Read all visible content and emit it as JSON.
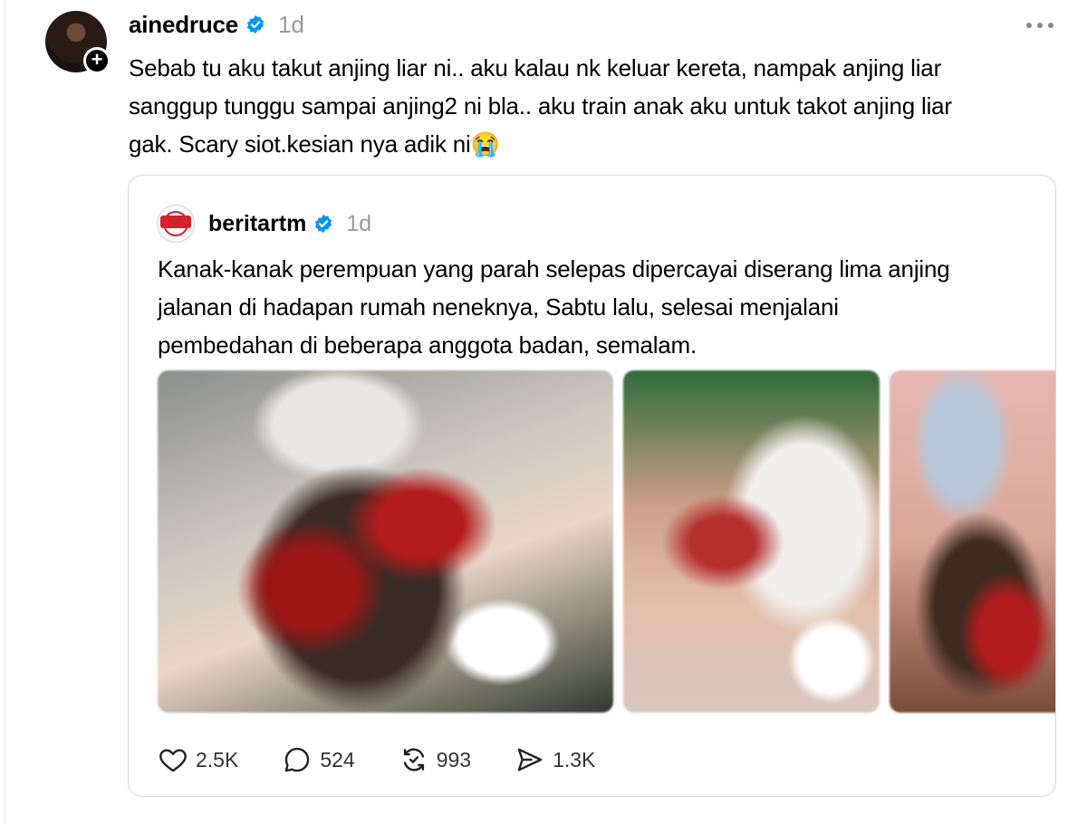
{
  "post": {
    "username": "ainedruce",
    "time": "1d",
    "text": "Sebab tu aku takut anjing liar ni.. aku kalau nk keluar kereta, nampak anjing liar sanggup tunggu sampai anjing2 ni bla.. aku train anak aku untuk takot anjing liar gak. Scary siot.kesian nya adik ni😭",
    "follow_glyph": "+"
  },
  "quote": {
    "username": "beritartm",
    "time": "1d",
    "text": "Kanak-kanak perempuan yang parah selepas dipercayai diserang lima anjing jalanan di hadapan rumah neneknya, Sabtu lalu, selesai menjalani pembedahan di beberapa anggota badan, semalam.",
    "media_count": 3
  },
  "actions": {
    "likes": "2.5K",
    "replies": "524",
    "reposts": "993",
    "shares": "1.3K"
  },
  "colors": {
    "verified": "#0095f6",
    "muted": "#9a9a9a",
    "border": "#d8d8d8"
  },
  "icons": [
    "heart-icon",
    "reply-icon",
    "repost-icon",
    "share-icon",
    "verified-badge-icon",
    "more-icon"
  ]
}
